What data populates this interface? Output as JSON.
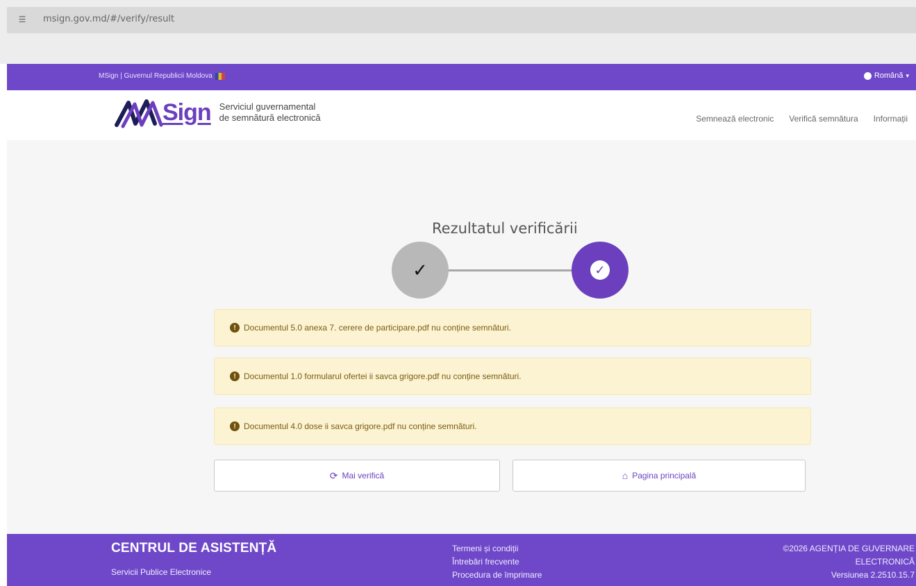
{
  "browser": {
    "url": "msign.gov.md/#/verify/result",
    "icon": "site-settings-icon"
  },
  "gov_strip": {
    "left_text": "MSign | Guvernul Republicii Moldova",
    "flag_icon": "moldova-flag-icon",
    "language": "Română",
    "language_icon": "globe-icon"
  },
  "header": {
    "logo_text": "Sign",
    "subtitle_line1": "Serviciul guvernamental",
    "subtitle_line2": "de semnătură electronică",
    "nav": [
      "Semnează electronic",
      "Verifică semnătura",
      "Informații"
    ]
  },
  "result": {
    "title": "Rezultatul verificării",
    "step_icon_1": "check-icon",
    "step_icon_2": "check-circle-icon"
  },
  "alerts": [
    "Documentul 5.0 anexa 7. cerere de participare.pdf nu conține semnături.",
    "Documentul 1.0 formularul ofertei ii savca grigore.pdf nu conține semnături.",
    "Documentul 4.0 dose ii savca grigore.pdf nu conține semnături."
  ],
  "buttons": {
    "verify_more": "Mai verifică",
    "home": "Pagina principală",
    "verify_icon": "refresh-icon",
    "home_icon": "home-icon"
  },
  "footer": {
    "title": "CENTRUL DE ASISTENȚĂ",
    "subtitle": "Servicii Publice Electronice",
    "links": [
      "Termeni și condiții",
      "Întrebări frecvente",
      "Procedura de împrimare"
    ],
    "copyright_line1": "©2026 AGENȚIA DE GUVERNARE",
    "copyright_line2": "ELECTRONICĂ",
    "version": "Versiunea 2.2510.15.7"
  },
  "colors": {
    "brand_purple": "#6f48c9",
    "alert_bg": "#fcf3d2",
    "alert_text": "#7a5c12"
  }
}
